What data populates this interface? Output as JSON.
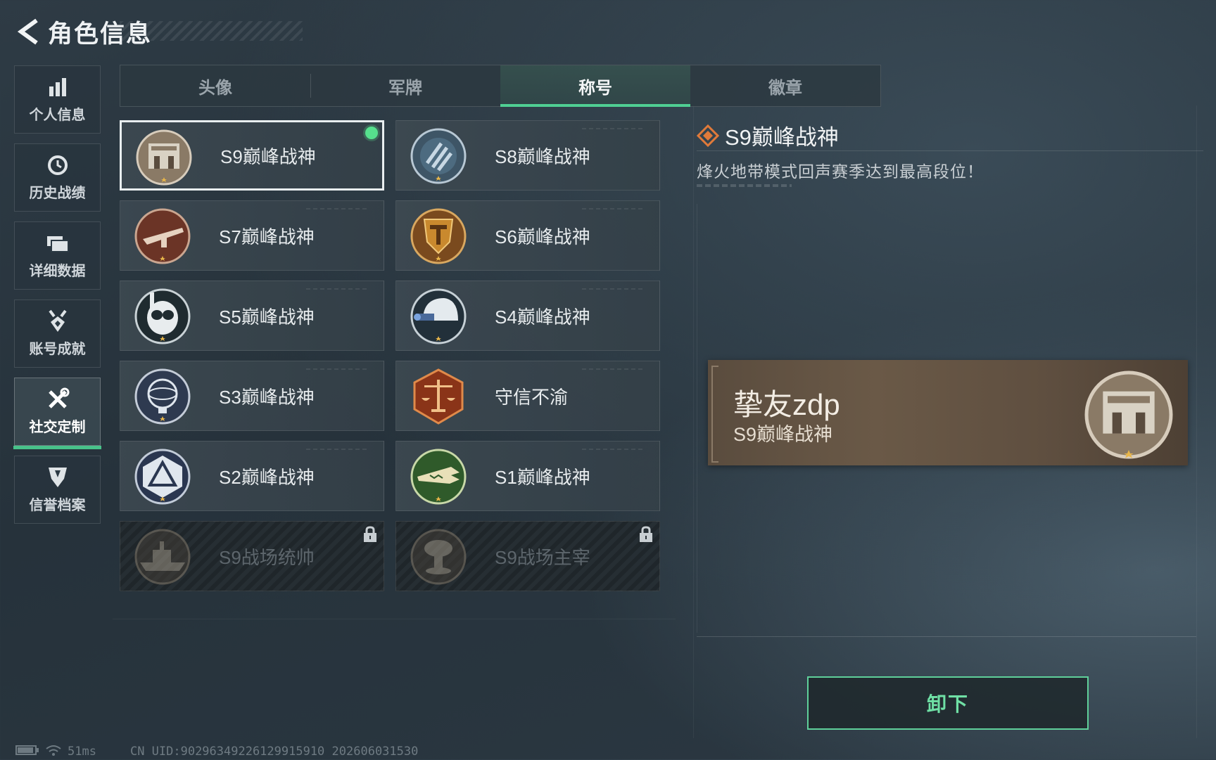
{
  "header": {
    "title": "角色信息"
  },
  "nav": {
    "items": [
      {
        "label": "个人信息",
        "icon": "bar-chart-icon",
        "active": false
      },
      {
        "label": "历史战绩",
        "icon": "clock-history-icon",
        "active": false
      },
      {
        "label": "详细数据",
        "icon": "folder-icon",
        "active": false
      },
      {
        "label": "账号成就",
        "icon": "achievement-medal-icon",
        "active": false
      },
      {
        "label": "社交定制",
        "icon": "tools-icon",
        "active": true
      },
      {
        "label": "信誉档案",
        "icon": "credit-shield-icon",
        "active": false
      }
    ]
  },
  "tabs": {
    "items": [
      {
        "label": "头像",
        "active": false
      },
      {
        "label": "军牌",
        "active": false
      },
      {
        "label": "称号",
        "active": true
      },
      {
        "label": "徽章",
        "active": false
      }
    ]
  },
  "titles": {
    "items": [
      {
        "name": "S9巅峰战神",
        "medal": "fortress-medal-icon",
        "selected": true,
        "equipped": true,
        "locked": false
      },
      {
        "name": "S8巅峰战神",
        "medal": "blue-stripes-medal-icon",
        "selected": false,
        "equipped": false,
        "locked": false
      },
      {
        "name": "S7巅峰战神",
        "medal": "rifle-medal-icon",
        "selected": false,
        "equipped": false,
        "locked": false
      },
      {
        "name": "S6巅峰战神",
        "medal": "gold-t-shield-medal-icon",
        "selected": false,
        "equipped": false,
        "locked": false
      },
      {
        "name": "S5巅峰战神",
        "medal": "diver-skull-medal-icon",
        "selected": false,
        "equipped": false,
        "locked": false
      },
      {
        "name": "S4巅峰战神",
        "medal": "night-vision-helmet-medal-icon",
        "selected": false,
        "equipped": false,
        "locked": false
      },
      {
        "name": "S3巅峰战神",
        "medal": "globe-medal-icon",
        "selected": false,
        "equipped": false,
        "locked": false
      },
      {
        "name": "守信不渝",
        "medal": "justice-scales-medal-icon",
        "selected": false,
        "equipped": false,
        "locked": false
      },
      {
        "name": "S2巅峰战神",
        "medal": "triangle-emblem-medal-icon",
        "selected": false,
        "equipped": false,
        "locked": false
      },
      {
        "name": "S1巅峰战神",
        "medal": "crocodile-medal-icon",
        "selected": false,
        "equipped": false,
        "locked": false
      },
      {
        "name": "S9战场统帅",
        "medal": "warship-medal-icon",
        "selected": false,
        "equipped": false,
        "locked": true
      },
      {
        "name": "S9战场主宰",
        "medal": "mushroom-cloud-medal-icon",
        "selected": false,
        "equipped": false,
        "locked": true
      }
    ]
  },
  "detail": {
    "title": "S9巅峰战神",
    "description": "烽火地带模式回声赛季达到最高段位！",
    "icon": "orange-diamond-icon"
  },
  "preview": {
    "player_name": "挚友zdp",
    "title": "S9巅峰战神",
    "medal": "fortress-medal-icon"
  },
  "actions": {
    "unequip_label": "卸下"
  },
  "status_bar": {
    "ping": "51ms",
    "uid": "CN UID:9029634922612991591​0 202606031530"
  },
  "colors": {
    "accent_green": "#4fcf93",
    "equipped_dot": "#56e08d",
    "preview_bg": "#6a5947",
    "diamond_orange": "#e07a3a"
  }
}
